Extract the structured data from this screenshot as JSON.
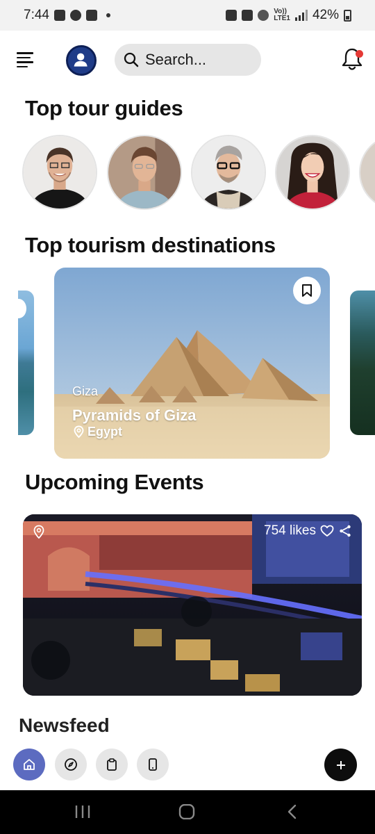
{
  "status_bar": {
    "time": "7:44",
    "signal_label_top": "Vo))",
    "signal_label_bottom": "LTE1",
    "battery_percent": "42%"
  },
  "topbar": {
    "search_placeholder": "Search...",
    "notification_dot_color": "#e53935"
  },
  "sections": {
    "guides_title": "Top tour guides",
    "destinations_title": "Top tourism destinations",
    "events_title": "Upcoming Events",
    "newsfeed_title": "Newsfeed"
  },
  "guides": [
    {
      "avatar": "guide-1-avatar"
    },
    {
      "avatar": "guide-2-avatar"
    },
    {
      "avatar": "guide-3-avatar"
    },
    {
      "avatar": "guide-4-avatar"
    }
  ],
  "destination": {
    "city": "Giza",
    "name": "Pyramids of Giza",
    "country": "Egypt",
    "icon_bookmark": "bookmark-icon",
    "icon_location": "location-pin-icon"
  },
  "event": {
    "likes": "754 likes",
    "icon_heart": "heart-icon",
    "icon_share": "share-icon",
    "icon_location": "location-pin-icon"
  },
  "bottom_nav": {
    "items": [
      {
        "icon": "home-icon",
        "active": true
      },
      {
        "icon": "compass-icon",
        "active": false
      },
      {
        "icon": "clipboard-icon",
        "active": false
      },
      {
        "icon": "phone-icon",
        "active": false
      }
    ],
    "fab_icon": "plus-icon",
    "accent_color": "#5c6bc0"
  }
}
